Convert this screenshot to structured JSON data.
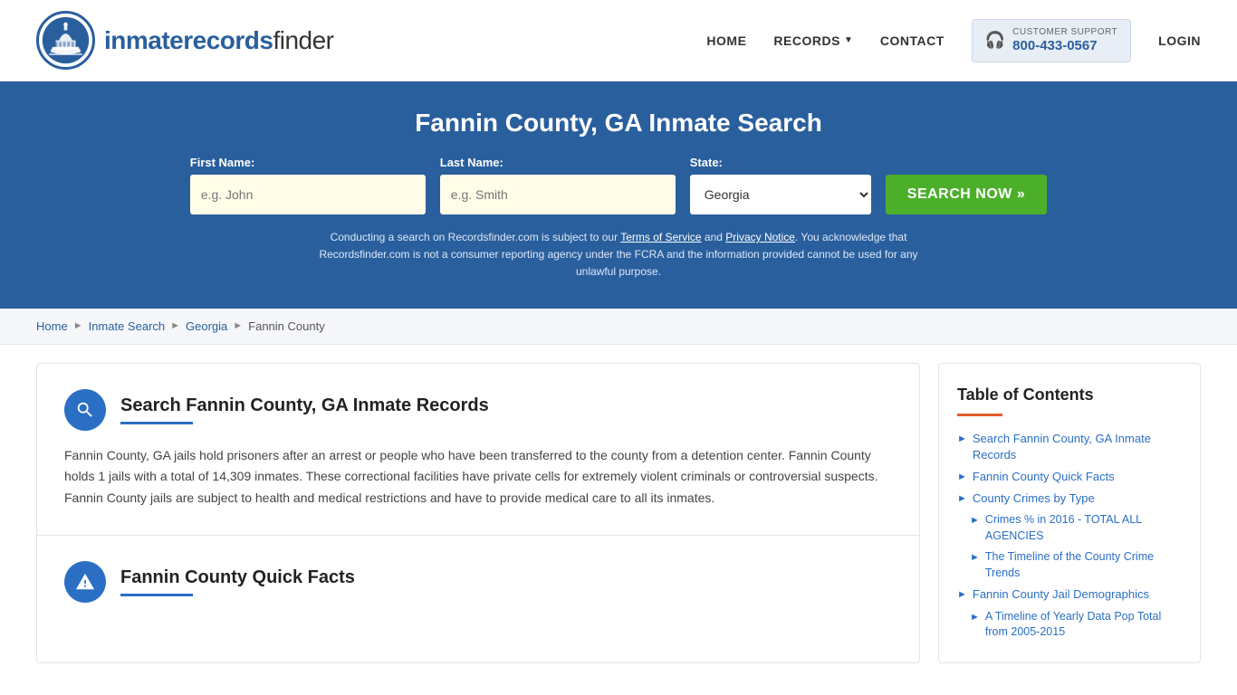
{
  "header": {
    "logo_text_main": "inmaterecords",
    "logo_text_bold": "finder",
    "nav": {
      "home": "HOME",
      "records": "RECORDS",
      "contact": "CONTACT",
      "login": "LOGIN"
    },
    "support": {
      "label": "CUSTOMER SUPPORT",
      "number": "800-433-0567"
    }
  },
  "hero": {
    "title": "Fannin County, GA Inmate Search",
    "first_name_label": "First Name:",
    "first_name_placeholder": "e.g. John",
    "last_name_label": "Last Name:",
    "last_name_placeholder": "e.g. Smith",
    "state_label": "State:",
    "state_value": "Georgia",
    "search_button": "SEARCH NOW »",
    "disclaimer": "Conducting a search on Recordsfinder.com is subject to our Terms of Service and Privacy Notice. You acknowledge that Recordsfinder.com is not a consumer reporting agency under the FCRA and the information provided cannot be used for any unlawful purpose."
  },
  "breadcrumb": {
    "items": [
      "Home",
      "Inmate Search",
      "Georgia",
      "Fannin County"
    ]
  },
  "sections": [
    {
      "id": "search-records",
      "icon": "search",
      "title": "Search Fannin County, GA Inmate Records",
      "body": "Fannin County, GA jails hold prisoners after an arrest or people who have been transferred to the county from a detention center. Fannin County holds 1 jails with a total of 14,309 inmates. These correctional facilities have private cells for extremely violent criminals or controversial suspects. Fannin County jails are subject to health and medical restrictions and have to provide medical care to all its inmates."
    },
    {
      "id": "quick-facts",
      "icon": "warning",
      "title": "Fannin County Quick Facts",
      "body": ""
    }
  ],
  "toc": {
    "title": "Table of Contents",
    "items": [
      {
        "label": "Search Fannin County, GA Inmate Records",
        "sub": false
      },
      {
        "label": "Fannin County Quick Facts",
        "sub": false
      },
      {
        "label": "County Crimes by Type",
        "sub": false
      },
      {
        "label": "Crimes % in 2016 - TOTAL ALL AGENCIES",
        "sub": true
      },
      {
        "label": "The Timeline of the County Crime Trends",
        "sub": true
      },
      {
        "label": "Fannin County Jail Demographics",
        "sub": false
      },
      {
        "label": "A Timeline of Yearly Data Pop Total from 2005-2015",
        "sub": true
      }
    ]
  },
  "colors": {
    "primary": "#2a5f9e",
    "accent": "#4caf2a",
    "toc_accent": "#e05c2a",
    "hero_bg": "#2a5f9e"
  }
}
